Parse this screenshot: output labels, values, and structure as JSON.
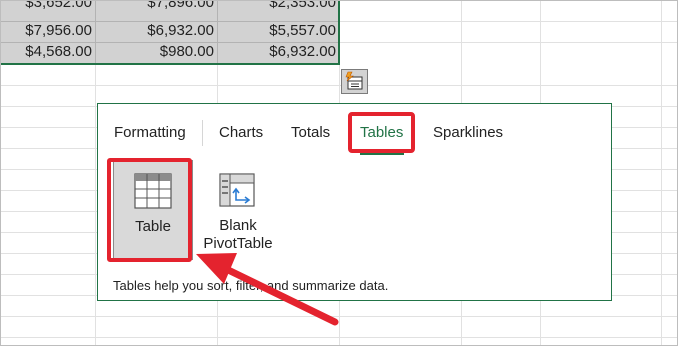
{
  "cells": [
    [
      "$3,652.00",
      "$7,896.00",
      "$2,353.00"
    ],
    [
      "$7,956.00",
      "$6,932.00",
      "$5,557.00"
    ],
    [
      "$4,568.00",
      "$980.00",
      "$6,932.00"
    ]
  ],
  "quick_analysis": {
    "icon": "quick-analysis-icon"
  },
  "tabs": [
    {
      "label": "Formatting",
      "active": false
    },
    {
      "label": "Charts",
      "active": false
    },
    {
      "label": "Totals",
      "active": false
    },
    {
      "label": "Tables",
      "active": true
    },
    {
      "label": "Sparklines",
      "active": false
    }
  ],
  "options": [
    {
      "label": "Table",
      "icon": "table-icon",
      "selected": true
    },
    {
      "label": "Blank\nPivotTable",
      "icon": "pivottable-icon",
      "selected": false
    }
  ],
  "option_labels": {
    "table": "Table",
    "pivot_line1": "Blank",
    "pivot_line2": "PivotTable"
  },
  "description": "Tables help you sort, filter, and summarize data.",
  "colors": {
    "accent": "#217346",
    "highlight": "#e4232e"
  }
}
